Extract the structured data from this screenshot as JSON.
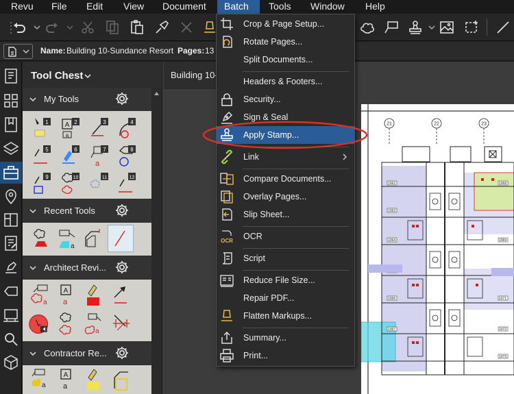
{
  "menubar": {
    "items": [
      "Revu",
      "File",
      "Edit",
      "View",
      "Document",
      "Batch",
      "Tools",
      "Window",
      "Help"
    ],
    "active": "Batch"
  },
  "docbar": {
    "name_label": "Name:",
    "name_value": "Building 10-Sundance Resort",
    "pages_label": "Pages:",
    "pages_value": "13"
  },
  "tool_chest": {
    "title": "Tool Chest",
    "sections": [
      {
        "label": "My Tools",
        "numbers": [
          "1",
          "2",
          "3",
          "4",
          "5",
          "6",
          "7",
          "8",
          "9",
          "10",
          "11",
          "12"
        ]
      },
      {
        "label": "Recent Tools"
      },
      {
        "label": "Architect Revi..."
      },
      {
        "label": "Contractor Re..."
      }
    ]
  },
  "document": {
    "tab_title": "Building 10-S",
    "grid_labels": [
      "21",
      "22",
      "23"
    ],
    "room_labels": [
      "1062",
      "1063",
      "1064",
      "1065",
      "1066",
      "1067",
      "1068",
      "1069",
      "1070",
      "1071",
      "1072",
      "1073"
    ]
  },
  "batch_menu": {
    "items": [
      {
        "label": "Crop & Page Setup...",
        "icon": "crop-icon"
      },
      {
        "label": "Rotate Pages...",
        "icon": "rotate-pages-icon"
      },
      {
        "label": "Split Documents...",
        "icon": ""
      },
      {
        "label": "Headers & Footers...",
        "icon": ""
      },
      {
        "label": "Security...",
        "icon": "lock-icon"
      },
      {
        "label": "Sign & Seal",
        "icon": "pen-nib-icon"
      },
      {
        "label": "Apply Stamp...",
        "icon": "stamp-icon"
      },
      {
        "label": "Link",
        "icon": "link-icon"
      },
      {
        "label": "Compare Documents...",
        "icon": "compare-icon"
      },
      {
        "label": "Overlay Pages...",
        "icon": "overlay-icon"
      },
      {
        "label": "Slip Sheet...",
        "icon": "slip-sheet-icon"
      },
      {
        "label": "OCR",
        "icon": "ocr-icon"
      },
      {
        "label": "Script",
        "icon": "script-icon"
      },
      {
        "label": "Reduce File Size...",
        "icon": "reduce-file-icon"
      },
      {
        "label": "Repair PDF...",
        "icon": ""
      },
      {
        "label": "Flatten Markups...",
        "icon": "flatten-icon"
      },
      {
        "label": "Summary...",
        "icon": "summary-icon"
      },
      {
        "label": "Print...",
        "icon": "printer-icon"
      }
    ],
    "ocr_icon_text": "OCR",
    "highlighted": "Apply Stamp..."
  },
  "colors": {
    "accent": "#2a5d97",
    "highlight_ring": "#d9302c",
    "panel": "#2d2d2d",
    "tool_bg": "#d3d1cb"
  }
}
